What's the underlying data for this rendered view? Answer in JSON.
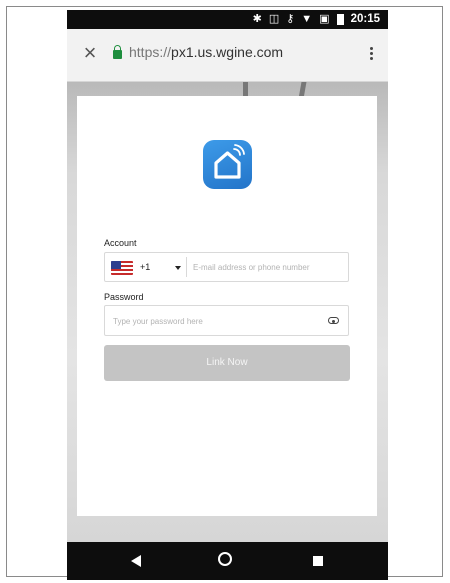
{
  "status_bar": {
    "time": "20:15",
    "icons": [
      "bluetooth-icon",
      "vibrate-icon",
      "vpn-key-icon",
      "wifi-icon",
      "no-sim-icon",
      "battery-icon"
    ]
  },
  "browser": {
    "url_scheme": "https://",
    "url_host": "px1.us.wgine.com",
    "close_icon": "close-icon",
    "menu_icon": "more-vert-icon"
  },
  "form": {
    "logo": "smart-home-icon",
    "account_label": "Account",
    "country_code": "+1",
    "account_placeholder": "E-mail address or phone number",
    "password_label": "Password",
    "password_placeholder": "Type your password here",
    "submit_label": "Link Now"
  },
  "colors": {
    "logo_blue": "#2f86dc",
    "button_disabled": "#c4c4c4",
    "lock_green": "#1e8e3e"
  },
  "nav_bar": {
    "icons": [
      "back-icon",
      "home-icon",
      "recents-icon"
    ]
  }
}
